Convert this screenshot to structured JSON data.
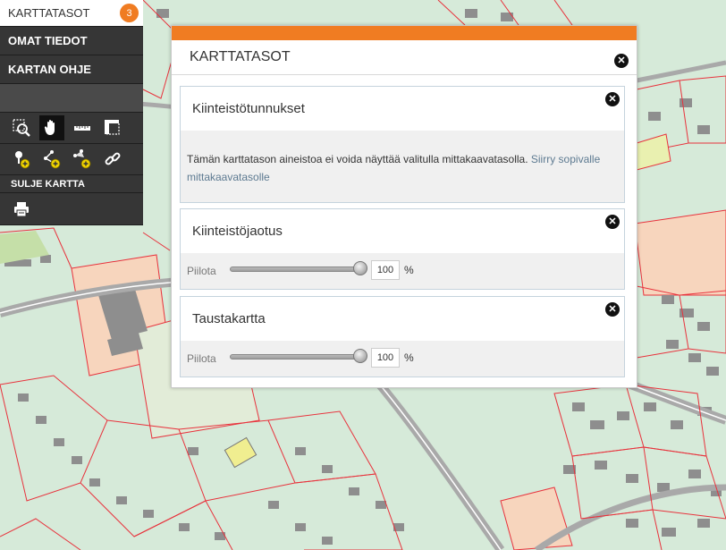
{
  "nav": {
    "active_label": "KARTTATASOT",
    "badge_count": "3",
    "items": [
      "OMAT TIEDOT",
      "KARTAN OHJE"
    ],
    "tools_title": "SULJE KARTTA"
  },
  "dialog": {
    "title": "KARTTATASOT",
    "close_symbol": "✕",
    "layers": [
      {
        "name": "Kiinteistötunnukset",
        "message": "Tämän karttatason aineistoa ei voida näyttää valitulla mittakaavatasolla.",
        "link": "Siirry sopivalle mittakaavatasolle"
      },
      {
        "name": "Kiinteistöjaotus",
        "hide_label": "Piilota",
        "opacity": "100",
        "unit": "%"
      },
      {
        "name": "Taustakartta",
        "hide_label": "Piilota",
        "opacity": "100",
        "unit": "%"
      }
    ]
  },
  "colors": {
    "accent": "#f07c22",
    "nav_bg": "#363636",
    "map_base": "#d6ead9",
    "parcel_line": "#e8323c",
    "road": "#a9a9a9",
    "building": "#8e8e8e"
  },
  "icons": [
    "zoom-box-icon",
    "pan-hand-icon",
    "measure-line-icon",
    "measure-area-icon",
    "add-marker-icon",
    "add-route-icon",
    "add-area-icon",
    "link-icon",
    "print-icon"
  ]
}
